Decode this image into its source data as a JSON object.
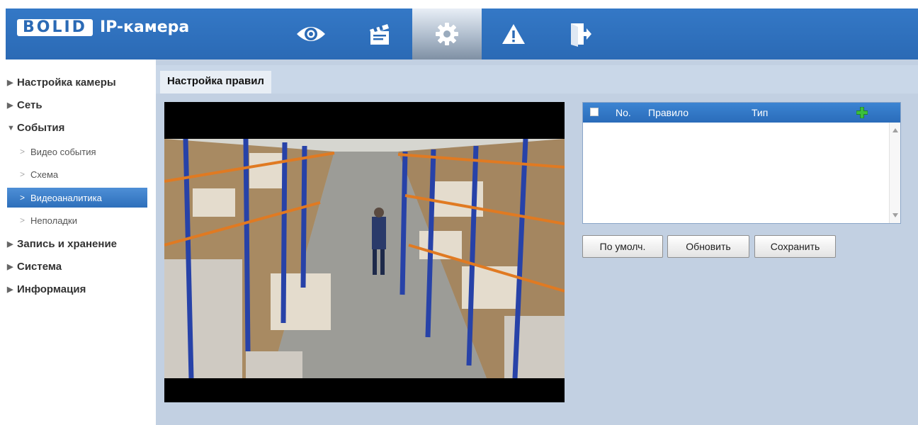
{
  "header": {
    "logo_brand": "BOLID",
    "logo_product": "IP-камера",
    "nav": [
      {
        "icon": "eye-icon",
        "label": "Просмотр"
      },
      {
        "icon": "clapperboard-icon",
        "label": "Воспроизведение"
      },
      {
        "icon": "gear-icon",
        "label": "Настройки",
        "active": true
      },
      {
        "icon": "warning-icon",
        "label": "Тревога"
      },
      {
        "icon": "logout-icon",
        "label": "Выход"
      }
    ]
  },
  "sidebar": {
    "items": [
      {
        "label": "Настройка камеры",
        "expanded": false
      },
      {
        "label": "Сеть",
        "expanded": false
      },
      {
        "label": "События",
        "expanded": true
      },
      {
        "label": "Запись и хранение",
        "expanded": false
      },
      {
        "label": "Система",
        "expanded": false
      },
      {
        "label": "Информация",
        "expanded": false
      }
    ],
    "events_subitems": [
      {
        "label": "Видео события",
        "active": false
      },
      {
        "label": "Схема",
        "active": false
      },
      {
        "label": "Видеоаналитика",
        "active": true
      },
      {
        "label": "Неполадки",
        "active": false
      }
    ]
  },
  "main": {
    "tab_label": "Настройка правил",
    "rules_table": {
      "columns": [
        "No.",
        "Правило",
        "Тип"
      ],
      "rows": []
    },
    "buttons": {
      "default_label": "По умолч.",
      "refresh_label": "Обновить",
      "save_label": "Сохранить"
    }
  },
  "colors": {
    "header_blue": "#2b6ab5",
    "content_bg": "#c2d0e2",
    "active_item": "#3a7cc9",
    "add_icon_green": "#3bbf3b"
  }
}
